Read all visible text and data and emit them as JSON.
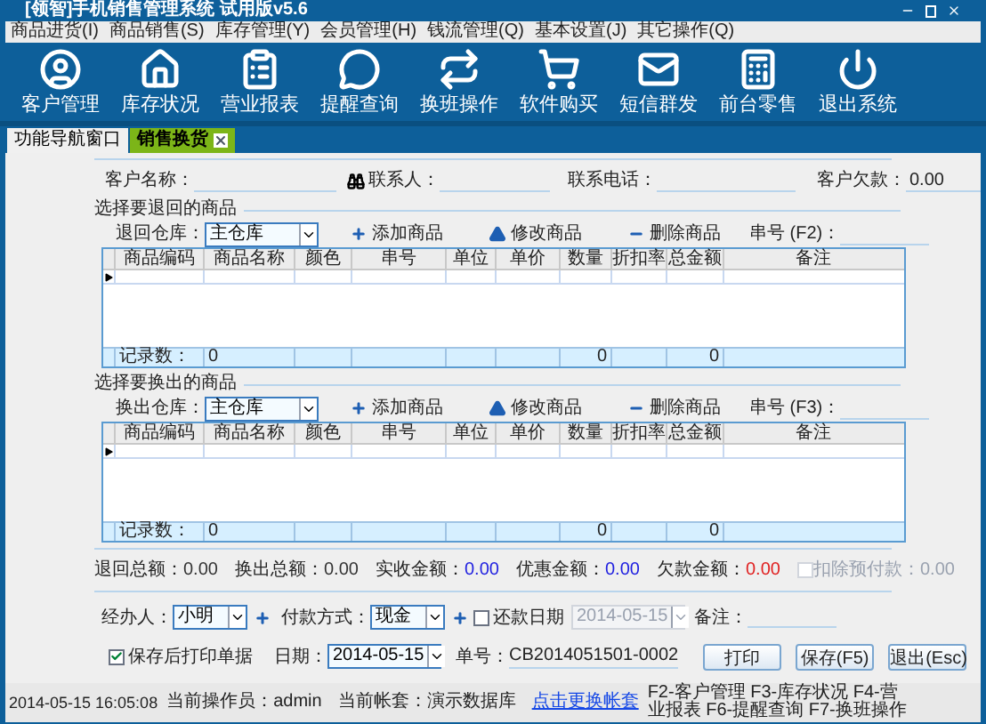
{
  "window": {
    "title": "[领智]手机销售管理系统 试用版v5.6"
  },
  "menu": [
    "商品进货(I)",
    "商品销售(S)",
    "库存管理(Y)",
    "会员管理(H)",
    "钱流管理(Q)",
    "基本设置(J)",
    "其它操作(Q)"
  ],
  "toolbar": [
    {
      "label": "客户管理"
    },
    {
      "label": "库存状况"
    },
    {
      "label": "营业报表"
    },
    {
      "label": "提醒查询"
    },
    {
      "label": "换班操作"
    },
    {
      "label": "软件购买"
    },
    {
      "label": "短信群发"
    },
    {
      "label": "前台零售"
    },
    {
      "label": "退出系统"
    }
  ],
  "tabs": [
    {
      "label": "功能导航窗口",
      "selected": false,
      "closable": false
    },
    {
      "label": "销售换货",
      "selected": true,
      "closable": true
    }
  ],
  "customer": [
    {
      "label": "客户名称：",
      "search": true
    },
    {
      "label": "联系人：",
      "search": false
    },
    {
      "label": "联系电话：",
      "search": false
    },
    {
      "label": "客户欠款：",
      "value": "0.00",
      "search": false
    }
  ],
  "sections": [
    {
      "title": "选择要退回的商品",
      "warehouse_label": "退回仓库：",
      "warehouse": "主仓库",
      "actions": [
        "添加商品",
        "修改商品",
        "删除商品"
      ],
      "serial_label": "串号 (F2)：",
      "columns": [
        "商品编码",
        "商品名称",
        "颜色",
        "串号",
        "单位",
        "单价",
        "数量",
        "折扣率",
        "总金额",
        "备注"
      ],
      "footer": {
        "label": "记录数：",
        "count": "0",
        "quantity": "0",
        "total": "0"
      }
    },
    {
      "title": "选择要换出的商品",
      "warehouse_label": "换出仓库：",
      "warehouse": "主仓库",
      "actions": [
        "添加商品",
        "修改商品",
        "删除商品"
      ],
      "serial_label": "串号 (F3)：",
      "columns": [
        "商品编码",
        "商品名称",
        "颜色",
        "串号",
        "单位",
        "单价",
        "数量",
        "折扣率",
        "总金额",
        "备注"
      ],
      "footer": {
        "label": "记录数：",
        "count": "0",
        "quantity": "0",
        "total": "0"
      }
    }
  ],
  "totals": [
    {
      "kind": "text",
      "label": "退回总额：",
      "value": "0.00",
      "color": "#333333"
    },
    {
      "kind": "text",
      "label": "换出总额：",
      "value": "0.00",
      "color": "#333333"
    },
    {
      "kind": "text",
      "label": "实收金额：",
      "value": "0.00",
      "color": "#2020e0"
    },
    {
      "kind": "text",
      "label": "优惠金额：",
      "value": "0.00",
      "color": "#2020e0"
    },
    {
      "kind": "text",
      "label": "欠款金额：",
      "value": "0.00",
      "color": "#e02020"
    },
    {
      "kind": "checkbox",
      "label": "扣除预付款：",
      "value": "0.00",
      "checked": false,
      "disabled": true
    }
  ],
  "form": {
    "handler_label": "经办人：",
    "handler": "小明",
    "payment_label": "付款方式：",
    "payment": "现金",
    "repay": {
      "label": "还款日期",
      "checked": false
    },
    "repay_date": {
      "value": "2014-05-15",
      "disabled": true
    },
    "note_label": "备注：",
    "print_after_save": {
      "label": "保存后打印单据",
      "checked": true
    },
    "date_label": "日期：",
    "date": "2014-05-15",
    "number_label": "单号：",
    "number": "CB2014051501-0002",
    "buttons": [
      "打印",
      "保存(F5)",
      "退出(Esc)"
    ]
  },
  "status_bar": {
    "time": "2014-05-15 16:05:08",
    "operator": "当前操作员：admin",
    "account": "当前帐套：演示数据库",
    "link": "点击更换帐套",
    "shortcuts": "F2-客户管理 F3-库存状况 F4-营业报表 F6-提醒查询 F7-换班操作"
  }
}
